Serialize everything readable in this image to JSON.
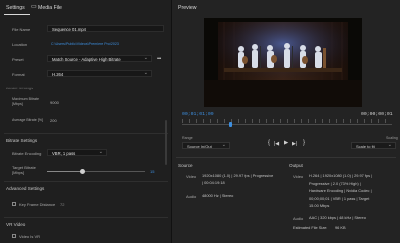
{
  "tabs": {
    "settings": "Settings",
    "media_file": "Media File"
  },
  "export": {
    "file_name_label": "File Name",
    "file_name_value": "Sequence 01.mp4",
    "location_label": "Location",
    "location_value": "C:\\Users\\Public\\Videos\\Premiere Pro\\2023",
    "preset_label": "Preset",
    "preset_value": "Match Source - Adaptive High Bitrate",
    "format_label": "Format",
    "format_value": "H.264"
  },
  "bitrate_partial": {
    "heading": "Bitrate Settings",
    "max_label": "Maximum Bitrate",
    "max_label_unit": "[Mbps]",
    "max_value": "9000",
    "avg_label": "Average Bitrate [%]",
    "avg_value": "200"
  },
  "bitrate_settings": {
    "title": "Bitrate Settings",
    "encoding_label": "Bitrate Encoding",
    "encoding_value": "VBR, 1 pass",
    "target_label": "Target Bitrate",
    "target_unit": "[Mbps]",
    "target_value": "15",
    "target_fraction": 0.36
  },
  "advanced": {
    "title": "Advanced Settings",
    "key_frame_label": "Key Frame Distance",
    "key_frame_value": "72",
    "key_frame_checked": false
  },
  "vr": {
    "title": "VR Video",
    "video_is_vr_label": "Video Is VR",
    "checked": false
  },
  "preview": {
    "title": "Preview",
    "timecode_in": "00;01;01;09",
    "timecode_out": "00;00;00;01",
    "playhead_fraction": 0.23,
    "range_label": "Range",
    "range_value": "Source In/Out",
    "scaling_label": "Scaling",
    "scaling_value": "Scale to fit",
    "icons": [
      "set-in-icon",
      "step-back-icon",
      "play-icon",
      "step-forward-icon",
      "set-out-icon"
    ]
  },
  "source": {
    "title": "Source",
    "video_key": "Video",
    "video_value_1": "1920x1080 (1.0) | 29.97 fps | Progressive",
    "video_value_2": "| 00:04:19:18",
    "audio_key": "Audio",
    "audio_value": "48000 Hz | Stereo"
  },
  "output": {
    "title": "Output",
    "video_key": "Video",
    "video_lines": [
      "H.264 | 1920x1080 (1.0) | 29.97 fps |",
      "Progressive | 2.0 (73% High) |",
      "Hardware Encoding | Nvidia Codec |",
      "00;00;00;01 | VBR | 1 pass | Target",
      "15.00 Mbps"
    ],
    "audio_key": "Audio",
    "audio_value": "AAC | 320 kbps | 48 kHz | Stereo",
    "file_size_label": "Estimated File Size:",
    "file_size_value": "96 KB"
  },
  "colors": {
    "accent": "#3d8fe0",
    "panel": "#1f1f1f",
    "background": "#232323"
  }
}
